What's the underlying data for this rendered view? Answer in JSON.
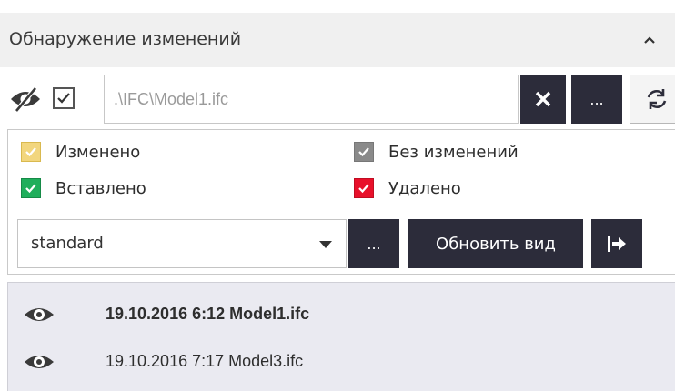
{
  "panel": {
    "title": "Обнаружение изменений",
    "collapse_icon": "chevron-up-icon"
  },
  "toolbar": {
    "visibility_icon": "eye-slash-icon",
    "visibility_checked": true,
    "path_value": ".\\IFC\\Model1.ifc",
    "clear_icon": "close-icon",
    "browse_label": "...",
    "refresh_icon": "refresh-icon"
  },
  "legend": {
    "items": [
      {
        "label": "Изменено",
        "color": "#f2d67e",
        "checked": true
      },
      {
        "label": "Без изменений",
        "color": "#8a8a8a",
        "checked": true
      },
      {
        "label": "Вставлено",
        "color": "#1fae5b",
        "checked": true
      },
      {
        "label": "Удалено",
        "color": "#e8102a",
        "checked": true
      }
    ]
  },
  "view": {
    "selected": "standard",
    "dots_label": "...",
    "update_label": "Обновить вид",
    "export_icon": "export-arrow-icon"
  },
  "history": [
    {
      "text": "19.10.2016 6:12 Model1.ifc",
      "bold": true,
      "icon": "eye-icon"
    },
    {
      "text": "19.10.2016 7:17 Model3.ifc",
      "bold": false,
      "icon": "eye-icon"
    }
  ],
  "colors": {
    "dark_button": "#2c2c3a",
    "header_bg": "#f0f0f0",
    "history_bg": "#eaeaf1"
  }
}
